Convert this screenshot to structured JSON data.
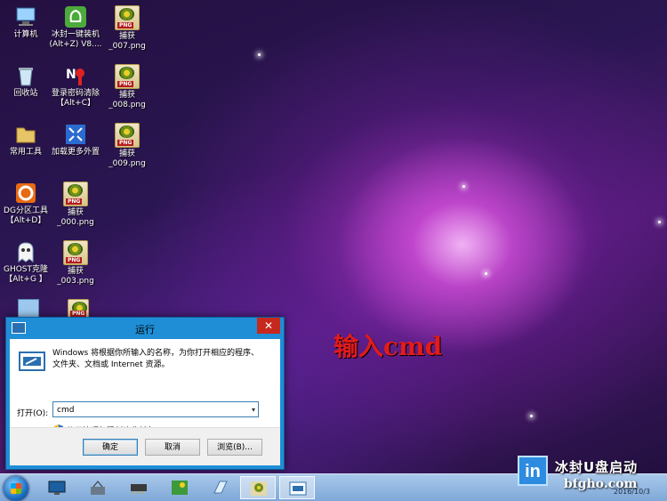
{
  "desktop": {
    "icons": [
      {
        "label": "计算机"
      },
      {
        "label": "冰封一键装机\n(Alt+Z) V8...."
      },
      {
        "label": "捕获\n_007.png"
      },
      {
        "label": "回收站"
      },
      {
        "label": "登录密码清除\n【Alt+C】"
      },
      {
        "label": "捕获\n_008.png"
      },
      {
        "label": "常用工具"
      },
      {
        "label": "加载更多外置"
      },
      {
        "label": "捕获\n_009.png"
      },
      {
        "label": "DG分区工具\n【Alt+D】"
      },
      {
        "label": "捕获\n_000.png"
      },
      {
        "label": "GHOST克隆\n【Alt+G 】"
      },
      {
        "label": "捕获\n_003.png"
      }
    ]
  },
  "annotation": "输入cmd",
  "run_dialog": {
    "title": "运行",
    "close_glyph": "✕",
    "description": "Windows 将根据你所输入的名称，为你打开相应的程序、文件夹、文档或 Internet 资源。",
    "open_label": "打开(O):",
    "open_value": "cmd",
    "admin_note": "使用管理权限创建此任务。",
    "ok_label": "确定",
    "cancel_label": "取消",
    "browse_label": "浏览(B)..."
  },
  "brand": {
    "logo_text": "in",
    "name": "冰封U盘启动",
    "site": "bfgho.com"
  },
  "clock": {
    "date": "2016/10/3"
  },
  "colors": {
    "annotation": "#e21b1b",
    "dialog_frame": "#1f8ed6",
    "close_button": "#c7281d"
  }
}
